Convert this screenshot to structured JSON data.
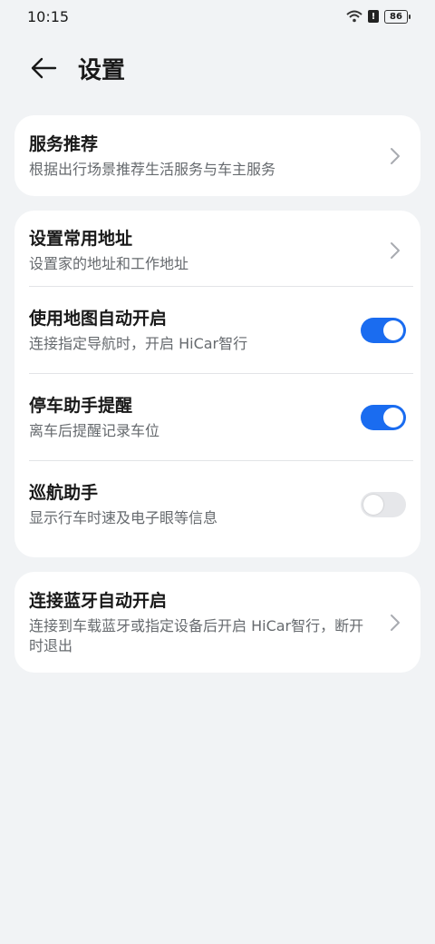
{
  "status_bar": {
    "time": "10:15",
    "battery": "86",
    "alert": "!"
  },
  "header": {
    "title": "设置"
  },
  "cards": {
    "service": {
      "title": "服务推荐",
      "subtitle": "根据出行场景推荐生活服务与车主服务"
    },
    "address": {
      "title": "设置常用地址",
      "subtitle": "设置家的地址和工作地址"
    },
    "map_auto": {
      "title": "使用地图自动开启",
      "subtitle": "连接指定导航时，开启 HiCar智行",
      "enabled": true
    },
    "parking": {
      "title": "停车助手提醒",
      "subtitle": "离车后提醒记录车位",
      "enabled": true
    },
    "cruise": {
      "title": "巡航助手",
      "subtitle": "显示行车时速及电子眼等信息",
      "enabled": false
    },
    "bluetooth": {
      "title": "连接蓝牙自动开启",
      "subtitle": "连接到车载蓝牙或指定设备后开启 HiCar智行，断开时退出"
    }
  },
  "colors": {
    "accent": "#1a6cf0",
    "background": "#f1f3f5"
  }
}
